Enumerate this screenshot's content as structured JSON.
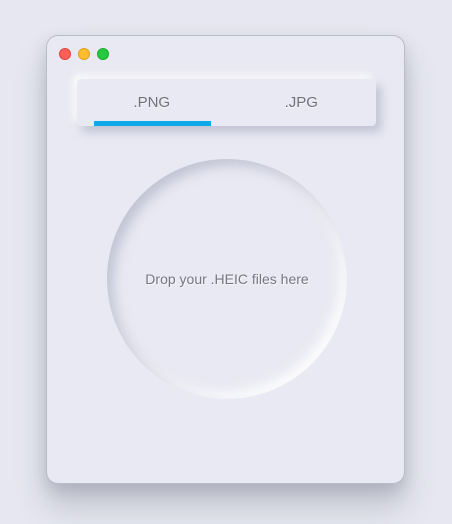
{
  "window": {
    "controls": {
      "close_color": "#fe5f57",
      "minimize_color": "#febc2e",
      "zoom_color": "#28c840"
    }
  },
  "tabs": {
    "items": [
      {
        "label": ".PNG",
        "selected": true
      },
      {
        "label": ".JPG",
        "selected": false
      }
    ],
    "accent_color": "#0da8e8"
  },
  "drop_zone": {
    "label": "Drop your .HEIC files here"
  }
}
